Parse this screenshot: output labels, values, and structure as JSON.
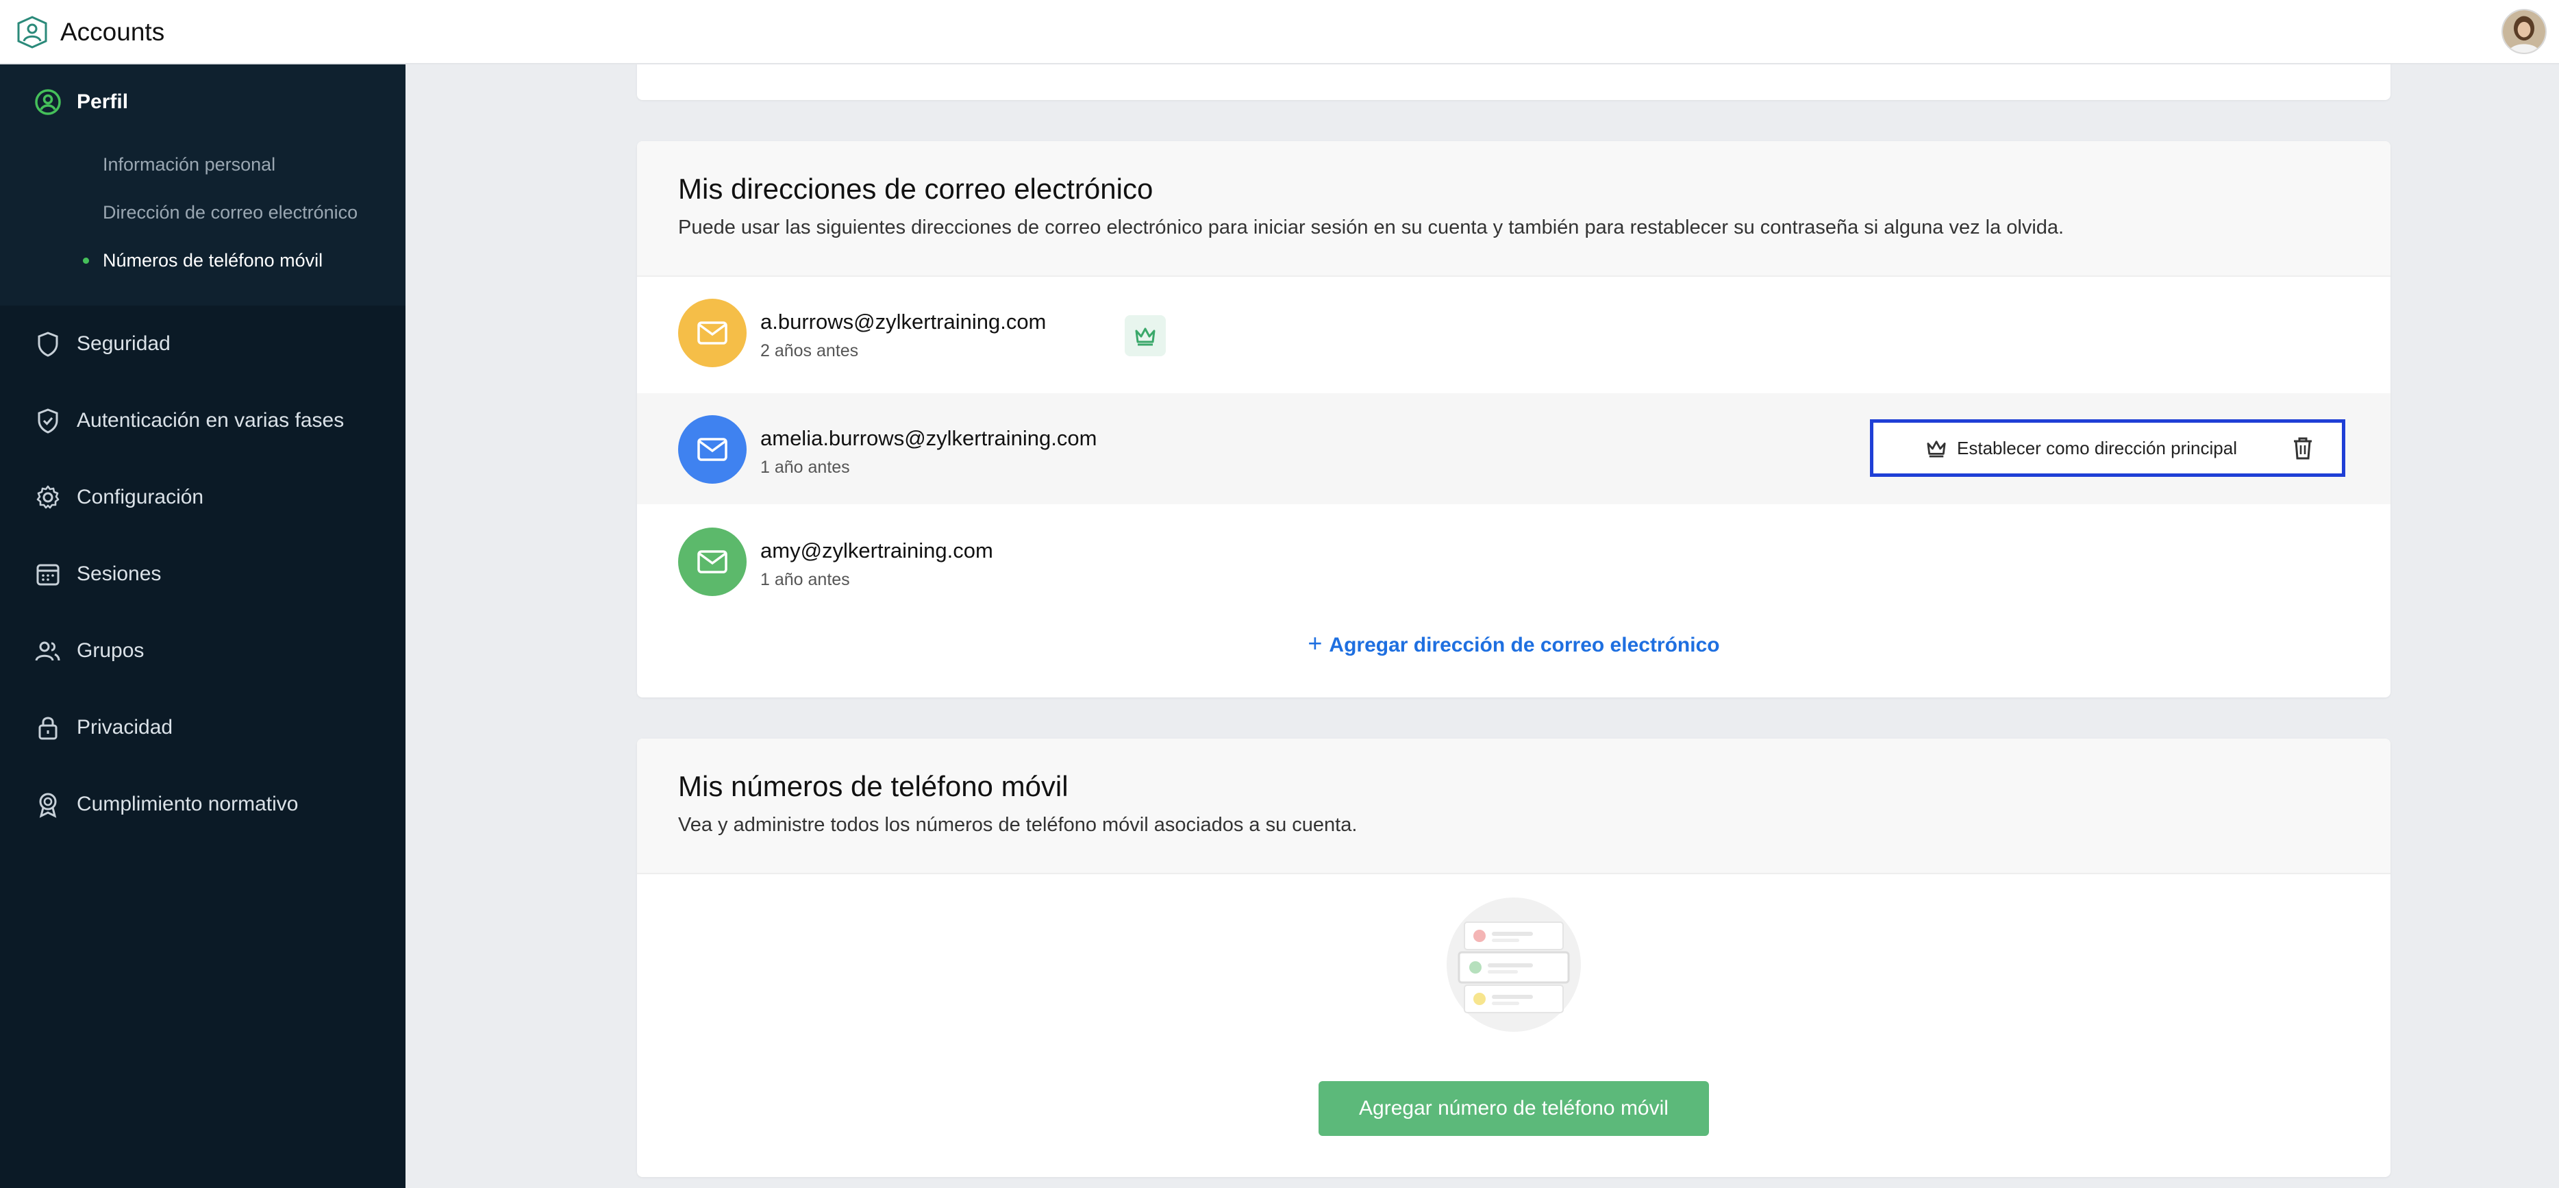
{
  "app": {
    "title": "Accounts"
  },
  "sidebar": {
    "profile": {
      "label": "Perfil",
      "subitems": [
        {
          "label": "Información personal"
        },
        {
          "label": "Dirección de correo electrónico"
        },
        {
          "label": "Números de teléfono móvil"
        }
      ]
    },
    "items": [
      {
        "label": "Seguridad",
        "icon": "shield-icon"
      },
      {
        "label": "Autenticación en varias fases",
        "icon": "shield-check-icon"
      },
      {
        "label": "Configuración",
        "icon": "gear-icon"
      },
      {
        "label": "Sesiones",
        "icon": "calendar-icon"
      },
      {
        "label": "Grupos",
        "icon": "users-icon"
      },
      {
        "label": "Privacidad",
        "icon": "lock-icon"
      },
      {
        "label": "Cumplimiento normativo",
        "icon": "badge-icon"
      }
    ]
  },
  "emails": {
    "title": "Mis direcciones de correo electrónico",
    "description": "Puede usar las siguientes direcciones de correo electrónico para iniciar sesión en su cuenta y también para restablecer su contraseña si alguna vez la olvida.",
    "list": [
      {
        "address": "a.burrows@zylkertraining.com",
        "time": "2 años antes",
        "color": "#f5be48",
        "primary": true
      },
      {
        "address": "amelia.burrows@zylkertraining.com",
        "time": "1 año antes",
        "color": "#3f82f0",
        "primary": false
      },
      {
        "address": "amy@zylkertraining.com",
        "time": "1 año antes",
        "color": "#5cb96b",
        "primary": false
      }
    ],
    "set_primary_label": "Establecer como dirección principal",
    "add_label": "Agregar dirección de correo electrónico"
  },
  "phones": {
    "title": "Mis números de teléfono móvil",
    "description": "Vea y administre todos los números de teléfono móvil asociados a su cuenta.",
    "add_button": "Agregar número de teléfono móvil"
  },
  "colors": {
    "sidebar_bg": "#0b1a26",
    "accent_green": "#45c05a",
    "link_blue": "#1e6fe0",
    "focus_outline": "#1f3fd6"
  }
}
